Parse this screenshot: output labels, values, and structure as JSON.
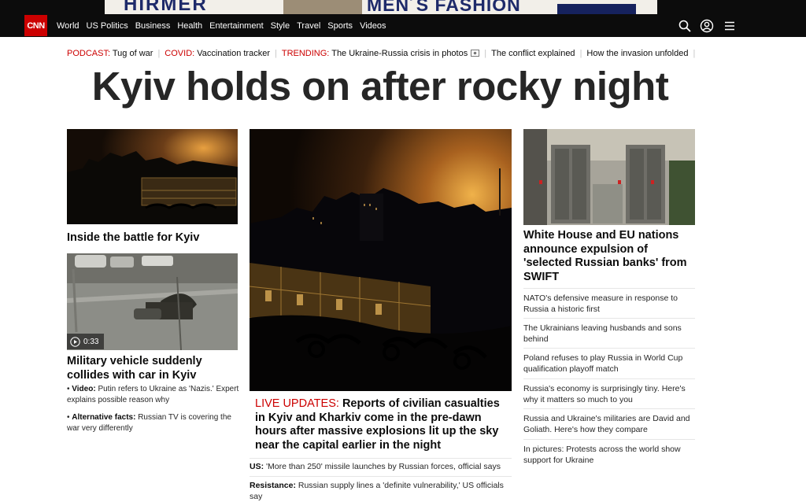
{
  "ad": {
    "left_text": "HIRMER",
    "right_text": "MEN´S FASHION"
  },
  "nav": {
    "logo": "CNN",
    "links": [
      "World",
      "US Politics",
      "Business",
      "Health",
      "Entertainment",
      "Style",
      "Travel",
      "Sports",
      "Videos"
    ],
    "icons": [
      "search-icon",
      "account-icon",
      "menu-icon"
    ]
  },
  "trending": [
    {
      "label": "PODCAST:",
      "text": "Tug of war"
    },
    {
      "label": "COVID:",
      "text": "Vaccination tracker"
    },
    {
      "label": "TRENDING:",
      "text": "The Ukraine-Russia crisis in photos"
    },
    {
      "label": "",
      "text": "The conflict explained"
    },
    {
      "label": "",
      "text": "How the invasion unfolded"
    }
  ],
  "headline": "Kyiv holds on after rocky night",
  "left_col": {
    "story1_title": "Inside the battle for Kyiv",
    "story2_title": "Military vehicle suddenly collides with car in Kyiv",
    "video_duration": "0:33",
    "bullets": [
      {
        "label": "Video:",
        "text": "Putin refers to Ukraine as 'Nazis.' Expert explains possible reason why"
      },
      {
        "label": "Alternative facts:",
        "text": "Russian TV is covering the war very differently"
      }
    ]
  },
  "center_col": {
    "live_label": "LIVE UPDATES:",
    "live_text": "Reports of civilian casualties in Kyiv and Kharkiv come in the pre-dawn hours after massive explosions lit up the sky near the capital earlier in the night",
    "subs": [
      {
        "label": "US:",
        "text": "'More than 250' missile launches by Russian forces, official says"
      },
      {
        "label": "Resistance:",
        "text": "Russian supply lines a 'definite vulnerability,' US officials say"
      }
    ]
  },
  "right_col": {
    "title": "White House and EU nations announce expulsion of 'selected Russian banks' from SWIFT",
    "links": [
      "NATO's defensive measure in response to Russia a historic first",
      "The Ukrainians leaving husbands and sons behind",
      "Poland refuses to play Russia in World Cup qualification playoff match",
      "Russia's economy is surprisingly tiny. Here's why it matters so much to you",
      "Russia and Ukraine's militaries are David and Goliath. Here's how they compare",
      "In pictures: Protests across the world show support for Ukraine"
    ]
  },
  "colors": {
    "cnn_red": "#cc0000",
    "nav_bg": "#0c0c0c",
    "text": "#0c0c0c"
  }
}
